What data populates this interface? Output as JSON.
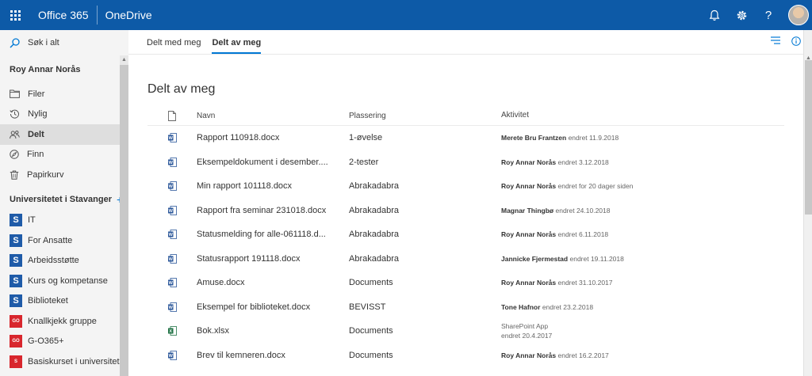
{
  "topbar": {
    "brand": "Office 365",
    "app": "OneDrive",
    "icons": [
      "bell-icon",
      "gear-icon",
      "help-icon"
    ]
  },
  "sidebar": {
    "search_label": "Søk i alt",
    "user_name": "Roy Annar Norås",
    "nav": [
      {
        "label": "Filer",
        "icon": "folder-icon",
        "active": false
      },
      {
        "label": "Nylig",
        "icon": "clock-icon",
        "active": false
      },
      {
        "label": "Delt",
        "icon": "shared-icon",
        "active": true
      },
      {
        "label": "Finn",
        "icon": "discover-icon",
        "active": false
      },
      {
        "label": "Papirkurv",
        "icon": "trash-icon",
        "active": false
      }
    ],
    "section_title": "Universitetet i Stavanger",
    "sites": [
      {
        "label": "IT",
        "logo": "S",
        "color": "blue"
      },
      {
        "label": "For Ansatte",
        "logo": "S",
        "color": "blue"
      },
      {
        "label": "Arbeidsstøtte",
        "logo": "S",
        "color": "blue"
      },
      {
        "label": "Kurs og kompetanse",
        "logo": "S",
        "color": "blue"
      },
      {
        "label": "Biblioteket",
        "logo": "S",
        "color": "blue"
      },
      {
        "label": "Knallkjekk gruppe",
        "logo": "GO",
        "color": "red"
      },
      {
        "label": "G-O365+",
        "logo": "GO",
        "color": "red"
      },
      {
        "label": "Basiskurset i universitetsp",
        "logo": "S",
        "color": "red"
      }
    ]
  },
  "main": {
    "tabs": [
      {
        "label": "Delt med meg",
        "active": false
      },
      {
        "label": "Delt av meg",
        "active": true
      }
    ],
    "title": "Delt av meg",
    "columns": {
      "name": "Navn",
      "location": "Plassering",
      "activity": "Aktivitet"
    },
    "rows": [
      {
        "type": "docx",
        "name": "Rapport 110918.docx",
        "location": "1-øvelse",
        "person": "Merete Bru Frantzen",
        "activity": "endret 11.9.2018"
      },
      {
        "type": "docx",
        "name": "Eksempeldokument i desember....",
        "location": "2-tester",
        "person": "Roy Annar Norås",
        "activity": "endret 3.12.2018"
      },
      {
        "type": "docx",
        "name": "Min rapport 101118.docx",
        "location": "Abrakadabra",
        "person": "Roy Annar Norås",
        "activity": "endret for 20 dager siden"
      },
      {
        "type": "docx",
        "name": "Rapport fra seminar 231018.docx",
        "location": "Abrakadabra",
        "person": "Magnar Thingbø",
        "activity": "endret 24.10.2018"
      },
      {
        "type": "docx",
        "name": "Statusmelding for alle-061118.d...",
        "location": "Abrakadabra",
        "person": "Roy Annar Norås",
        "activity": "endret 6.11.2018"
      },
      {
        "type": "docx",
        "name": "Statusrapport 191118.docx",
        "location": "Abrakadabra",
        "person": "Jannicke Fjermestad",
        "activity": "endret 19.11.2018"
      },
      {
        "type": "docx",
        "name": "Amuse.docx",
        "location": "Documents",
        "person": "Roy Annar Norås",
        "activity": "endret 31.10.2017"
      },
      {
        "type": "docx",
        "name": "Eksempel for biblioteket.docx",
        "location": "BEVISST",
        "person": "Tone Hafnor",
        "activity": "endret 23.2.2018"
      },
      {
        "type": "xlsx",
        "name": "Bok.xlsx",
        "location": "Documents",
        "person": "",
        "activity_line1": "SharePoint App",
        "activity": "endret 20.4.2017"
      },
      {
        "type": "docx",
        "name": "Brev til kemneren.docx",
        "location": "Documents",
        "person": "Roy Annar Norås",
        "activity": "endret 16.2.2017"
      }
    ]
  },
  "colors": {
    "topbar": "#0d5aa7",
    "accent": "#0078d4",
    "sidebar_bg": "#f4f4f4",
    "word": "#2b579a",
    "excel": "#217346",
    "site_blue": "#1f5ba8",
    "site_red": "#d8262d"
  }
}
